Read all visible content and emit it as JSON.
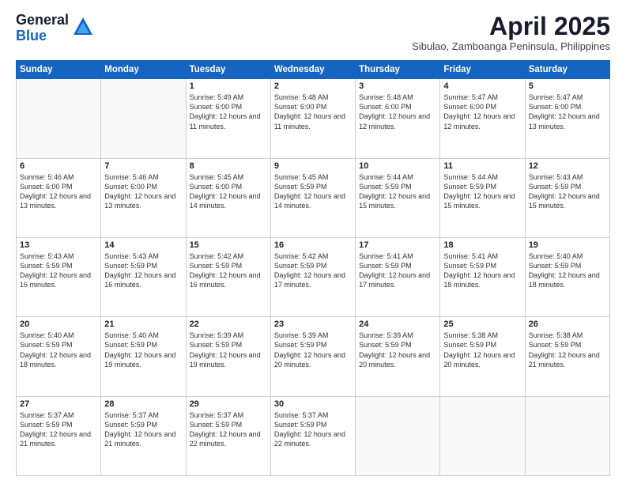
{
  "logo": {
    "general": "General",
    "blue": "Blue"
  },
  "title": "April 2025",
  "subtitle": "Sibulao, Zamboanga Peninsula, Philippines",
  "days_of_week": [
    "Sunday",
    "Monday",
    "Tuesday",
    "Wednesday",
    "Thursday",
    "Friday",
    "Saturday"
  ],
  "weeks": [
    [
      {
        "day": "",
        "info": ""
      },
      {
        "day": "",
        "info": ""
      },
      {
        "day": "1",
        "info": "Sunrise: 5:49 AM\nSunset: 6:00 PM\nDaylight: 12 hours and 11 minutes."
      },
      {
        "day": "2",
        "info": "Sunrise: 5:48 AM\nSunset: 6:00 PM\nDaylight: 12 hours and 11 minutes."
      },
      {
        "day": "3",
        "info": "Sunrise: 5:48 AM\nSunset: 6:00 PM\nDaylight: 12 hours and 12 minutes."
      },
      {
        "day": "4",
        "info": "Sunrise: 5:47 AM\nSunset: 6:00 PM\nDaylight: 12 hours and 12 minutes."
      },
      {
        "day": "5",
        "info": "Sunrise: 5:47 AM\nSunset: 6:00 PM\nDaylight: 12 hours and 13 minutes."
      }
    ],
    [
      {
        "day": "6",
        "info": "Sunrise: 5:46 AM\nSunset: 6:00 PM\nDaylight: 12 hours and 13 minutes."
      },
      {
        "day": "7",
        "info": "Sunrise: 5:46 AM\nSunset: 6:00 PM\nDaylight: 12 hours and 13 minutes."
      },
      {
        "day": "8",
        "info": "Sunrise: 5:45 AM\nSunset: 6:00 PM\nDaylight: 12 hours and 14 minutes."
      },
      {
        "day": "9",
        "info": "Sunrise: 5:45 AM\nSunset: 5:59 PM\nDaylight: 12 hours and 14 minutes."
      },
      {
        "day": "10",
        "info": "Sunrise: 5:44 AM\nSunset: 5:59 PM\nDaylight: 12 hours and 15 minutes."
      },
      {
        "day": "11",
        "info": "Sunrise: 5:44 AM\nSunset: 5:59 PM\nDaylight: 12 hours and 15 minutes."
      },
      {
        "day": "12",
        "info": "Sunrise: 5:43 AM\nSunset: 5:59 PM\nDaylight: 12 hours and 15 minutes."
      }
    ],
    [
      {
        "day": "13",
        "info": "Sunrise: 5:43 AM\nSunset: 5:59 PM\nDaylight: 12 hours and 16 minutes."
      },
      {
        "day": "14",
        "info": "Sunrise: 5:43 AM\nSunset: 5:59 PM\nDaylight: 12 hours and 16 minutes."
      },
      {
        "day": "15",
        "info": "Sunrise: 5:42 AM\nSunset: 5:59 PM\nDaylight: 12 hours and 16 minutes."
      },
      {
        "day": "16",
        "info": "Sunrise: 5:42 AM\nSunset: 5:59 PM\nDaylight: 12 hours and 17 minutes."
      },
      {
        "day": "17",
        "info": "Sunrise: 5:41 AM\nSunset: 5:59 PM\nDaylight: 12 hours and 17 minutes."
      },
      {
        "day": "18",
        "info": "Sunrise: 5:41 AM\nSunset: 5:59 PM\nDaylight: 12 hours and 18 minutes."
      },
      {
        "day": "19",
        "info": "Sunrise: 5:40 AM\nSunset: 5:59 PM\nDaylight: 12 hours and 18 minutes."
      }
    ],
    [
      {
        "day": "20",
        "info": "Sunrise: 5:40 AM\nSunset: 5:59 PM\nDaylight: 12 hours and 18 minutes."
      },
      {
        "day": "21",
        "info": "Sunrise: 5:40 AM\nSunset: 5:59 PM\nDaylight: 12 hours and 19 minutes."
      },
      {
        "day": "22",
        "info": "Sunrise: 5:39 AM\nSunset: 5:59 PM\nDaylight: 12 hours and 19 minutes."
      },
      {
        "day": "23",
        "info": "Sunrise: 5:39 AM\nSunset: 5:59 PM\nDaylight: 12 hours and 20 minutes."
      },
      {
        "day": "24",
        "info": "Sunrise: 5:39 AM\nSunset: 5:59 PM\nDaylight: 12 hours and 20 minutes."
      },
      {
        "day": "25",
        "info": "Sunrise: 5:38 AM\nSunset: 5:59 PM\nDaylight: 12 hours and 20 minutes."
      },
      {
        "day": "26",
        "info": "Sunrise: 5:38 AM\nSunset: 5:59 PM\nDaylight: 12 hours and 21 minutes."
      }
    ],
    [
      {
        "day": "27",
        "info": "Sunrise: 5:37 AM\nSunset: 5:59 PM\nDaylight: 12 hours and 21 minutes."
      },
      {
        "day": "28",
        "info": "Sunrise: 5:37 AM\nSunset: 5:59 PM\nDaylight: 12 hours and 21 minutes."
      },
      {
        "day": "29",
        "info": "Sunrise: 5:37 AM\nSunset: 5:59 PM\nDaylight: 12 hours and 22 minutes."
      },
      {
        "day": "30",
        "info": "Sunrise: 5:37 AM\nSunset: 5:59 PM\nDaylight: 12 hours and 22 minutes."
      },
      {
        "day": "",
        "info": ""
      },
      {
        "day": "",
        "info": ""
      },
      {
        "day": "",
        "info": ""
      }
    ]
  ]
}
